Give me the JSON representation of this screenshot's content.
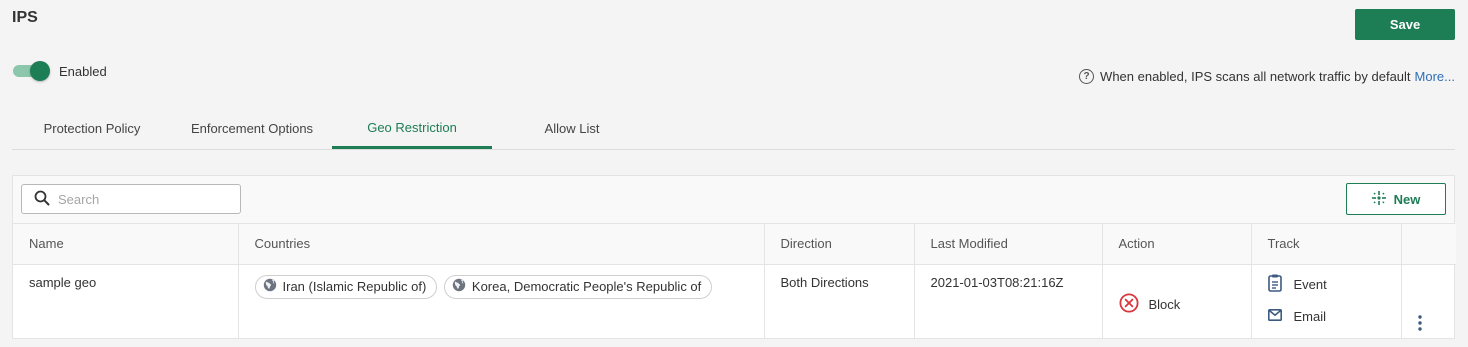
{
  "header": {
    "title": "IPS",
    "save_label": "Save"
  },
  "status": {
    "toggle_label": "Enabled",
    "enabled": true,
    "help_text": "When enabled, IPS scans all network traffic by default",
    "more_link": "More..."
  },
  "tabs": [
    {
      "label": "Protection Policy",
      "active": false
    },
    {
      "label": "Enforcement Options",
      "active": false
    },
    {
      "label": "Geo Restriction",
      "active": true
    },
    {
      "label": "Allow List",
      "active": false
    }
  ],
  "toolbar": {
    "search_placeholder": "Search",
    "new_label": "New"
  },
  "table": {
    "columns": [
      "Name",
      "Countries",
      "Direction",
      "Last Modified",
      "Action",
      "Track",
      ""
    ],
    "rows": [
      {
        "name": "sample geo",
        "countries": [
          "Iran (Islamic Republic of)",
          "Korea, Democratic People's Republic of"
        ],
        "direction": "Both Directions",
        "last_modified": "2021-01-03T08:21:16Z",
        "action": "Block",
        "track": [
          "Event",
          "Email"
        ]
      }
    ]
  },
  "colors": {
    "accent": "#1d7d55",
    "link": "#2f6fb6",
    "block": "#d9363e",
    "track_icon": "#3d5a80"
  },
  "icons": {
    "help": "question-circle-icon",
    "search": "magnifier-icon",
    "new": "sparkle-icon",
    "country": "globe-icon",
    "block": "x-circle-icon",
    "event": "clipboard-icon",
    "email": "envelope-icon",
    "row_menu": "kebab-menu-icon"
  }
}
